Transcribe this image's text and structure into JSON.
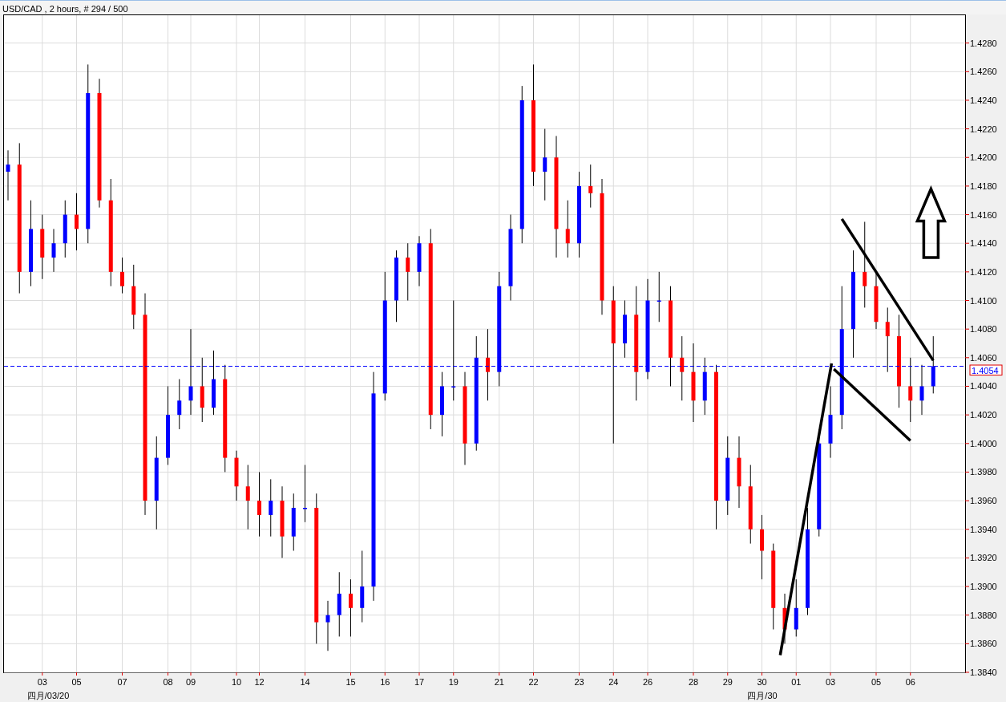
{
  "window": {
    "title": "USD/CAD , 2 hours, # 294 / 500"
  },
  "chart_data": {
    "type": "candlestick",
    "ylim": [
      1.384,
      1.43
    ],
    "grid": true,
    "categories": [
      null,
      null,
      null,
      "03",
      null,
      null,
      "05",
      null,
      null,
      null,
      "07",
      null,
      null,
      null,
      "08",
      null,
      "09",
      null,
      null,
      null,
      "10",
      null,
      "12",
      null,
      null,
      null,
      "14",
      null,
      null,
      null,
      "15",
      null,
      null,
      "16",
      null,
      null,
      "17",
      null,
      null,
      "19",
      null,
      null,
      null,
      "21",
      null,
      null,
      "22",
      null,
      null,
      null,
      "23",
      null,
      null,
      "24",
      null,
      null,
      "26",
      null,
      null,
      null,
      "28",
      null,
      null,
      "29",
      null,
      null,
      "30",
      null,
      null,
      "01",
      null,
      null,
      "03",
      null,
      null,
      null,
      "05",
      null,
      null,
      "06",
      null,
      null
    ],
    "ohlc": [
      [
        1.419,
        1.4205,
        1.417,
        1.4195
      ],
      [
        1.4195,
        1.421,
        1.4105,
        1.412
      ],
      [
        1.412,
        1.417,
        1.411,
        1.415
      ],
      [
        1.415,
        1.416,
        1.4115,
        1.413
      ],
      [
        1.413,
        1.415,
        1.412,
        1.414
      ],
      [
        1.414,
        1.417,
        1.413,
        1.416
      ],
      [
        1.416,
        1.4175,
        1.4135,
        1.415
      ],
      [
        1.415,
        1.4265,
        1.414,
        1.4245
      ],
      [
        1.4245,
        1.4255,
        1.4165,
        1.417
      ],
      [
        1.417,
        1.4185,
        1.411,
        1.412
      ],
      [
        1.412,
        1.413,
        1.4105,
        1.411
      ],
      [
        1.411,
        1.4125,
        1.408,
        1.409
      ],
      [
        1.409,
        1.4105,
        1.395,
        1.396
      ],
      [
        1.396,
        1.4005,
        1.394,
        1.399
      ],
      [
        1.399,
        1.404,
        1.3985,
        1.402
      ],
      [
        1.402,
        1.4045,
        1.401,
        1.403
      ],
      [
        1.403,
        1.408,
        1.402,
        1.404
      ],
      [
        1.404,
        1.406,
        1.4015,
        1.4025
      ],
      [
        1.4025,
        1.4065,
        1.402,
        1.4045
      ],
      [
        1.4045,
        1.4055,
        1.398,
        1.399
      ],
      [
        1.399,
        1.3995,
        1.396,
        1.397
      ],
      [
        1.397,
        1.3985,
        1.394,
        1.396
      ],
      [
        1.396,
        1.398,
        1.3935,
        1.395
      ],
      [
        1.395,
        1.3975,
        1.3935,
        1.396
      ],
      [
        1.396,
        1.397,
        1.392,
        1.3935
      ],
      [
        1.3935,
        1.3965,
        1.3925,
        1.3955
      ],
      [
        1.3955,
        1.3985,
        1.3945,
        1.3955
      ],
      [
        1.3955,
        1.3965,
        1.386,
        1.3875
      ],
      [
        1.3875,
        1.389,
        1.3855,
        1.388
      ],
      [
        1.388,
        1.391,
        1.3865,
        1.3895
      ],
      [
        1.3895,
        1.3905,
        1.3865,
        1.3885
      ],
      [
        1.3885,
        1.3925,
        1.3875,
        1.39
      ],
      [
        1.39,
        1.405,
        1.389,
        1.4035
      ],
      [
        1.4035,
        1.412,
        1.403,
        1.41
      ],
      [
        1.41,
        1.4135,
        1.4085,
        1.413
      ],
      [
        1.413,
        1.414,
        1.41,
        1.412
      ],
      [
        1.412,
        1.4145,
        1.411,
        1.414
      ],
      [
        1.414,
        1.415,
        1.401,
        1.402
      ],
      [
        1.402,
        1.405,
        1.4005,
        1.404
      ],
      [
        1.404,
        1.41,
        1.403,
        1.404
      ],
      [
        1.404,
        1.405,
        1.3985,
        1.4
      ],
      [
        1.4,
        1.4075,
        1.3995,
        1.406
      ],
      [
        1.406,
        1.408,
        1.403,
        1.405
      ],
      [
        1.405,
        1.412,
        1.404,
        1.411
      ],
      [
        1.411,
        1.416,
        1.41,
        1.415
      ],
      [
        1.415,
        1.425,
        1.414,
        1.424
      ],
      [
        1.424,
        1.4265,
        1.418,
        1.419
      ],
      [
        1.419,
        1.422,
        1.417,
        1.42
      ],
      [
        1.42,
        1.4215,
        1.413,
        1.415
      ],
      [
        1.415,
        1.417,
        1.413,
        1.414
      ],
      [
        1.414,
        1.419,
        1.413,
        1.418
      ],
      [
        1.418,
        1.4195,
        1.4165,
        1.4175
      ],
      [
        1.4175,
        1.4185,
        1.409,
        1.41
      ],
      [
        1.41,
        1.411,
        1.4,
        1.407
      ],
      [
        1.407,
        1.41,
        1.406,
        1.409
      ],
      [
        1.409,
        1.411,
        1.403,
        1.405
      ],
      [
        1.405,
        1.4115,
        1.4045,
        1.41
      ],
      [
        1.41,
        1.412,
        1.4085,
        1.41
      ],
      [
        1.41,
        1.411,
        1.404,
        1.406
      ],
      [
        1.406,
        1.4075,
        1.403,
        1.405
      ],
      [
        1.405,
        1.407,
        1.4015,
        1.403
      ],
      [
        1.403,
        1.406,
        1.402,
        1.405
      ],
      [
        1.405,
        1.4055,
        1.394,
        1.396
      ],
      [
        1.396,
        1.4005,
        1.395,
        1.399
      ],
      [
        1.399,
        1.4005,
        1.3955,
        1.397
      ],
      [
        1.397,
        1.3985,
        1.393,
        1.394
      ],
      [
        1.394,
        1.395,
        1.3905,
        1.3925
      ],
      [
        1.3925,
        1.393,
        1.387,
        1.3885
      ],
      [
        1.3885,
        1.3895,
        1.386,
        1.387
      ],
      [
        1.387,
        1.3905,
        1.3865,
        1.3885
      ],
      [
        1.3885,
        1.3955,
        1.388,
        1.394
      ],
      [
        1.394,
        1.401,
        1.3935,
        1.4
      ],
      [
        1.4,
        1.404,
        1.399,
        1.402
      ],
      [
        1.402,
        1.411,
        1.401,
        1.408
      ],
      [
        1.408,
        1.4135,
        1.406,
        1.412
      ],
      [
        1.412,
        1.4155,
        1.4095,
        1.411
      ],
      [
        1.411,
        1.412,
        1.408,
        1.4085
      ],
      [
        1.4085,
        1.4095,
        1.405,
        1.4075
      ],
      [
        1.4075,
        1.409,
        1.4025,
        1.404
      ],
      [
        1.404,
        1.406,
        1.4015,
        1.403
      ],
      [
        1.403,
        1.4055,
        1.402,
        1.404
      ],
      [
        1.404,
        1.4075,
        1.4035,
        1.4054
      ]
    ],
    "yticks": [
      {
        "value": 1.384,
        "label": "1.3840"
      },
      {
        "value": 1.386,
        "label": "1.3860"
      },
      {
        "value": 1.388,
        "label": "1.3880"
      },
      {
        "value": 1.39,
        "label": "1.3900"
      },
      {
        "value": 1.392,
        "label": "1.3920"
      },
      {
        "value": 1.394,
        "label": "1.3940"
      },
      {
        "value": 1.396,
        "label": "1.3960"
      },
      {
        "value": 1.398,
        "label": "1.3980"
      },
      {
        "value": 1.4,
        "label": "1.4000"
      },
      {
        "value": 1.402,
        "label": "1.4020"
      },
      {
        "value": 1.404,
        "label": "1.4040"
      },
      {
        "value": 1.406,
        "label": "1.4060"
      },
      {
        "value": 1.408,
        "label": "1.4080"
      },
      {
        "value": 1.41,
        "label": "1.4100"
      },
      {
        "value": 1.412,
        "label": "1.4120"
      },
      {
        "value": 1.414,
        "label": "1.4140"
      },
      {
        "value": 1.416,
        "label": "1.4160"
      },
      {
        "value": 1.418,
        "label": "1.4180"
      },
      {
        "value": 1.42,
        "label": "1.4200"
      },
      {
        "value": 1.422,
        "label": "1.4220"
      },
      {
        "value": 1.424,
        "label": "1.4240"
      },
      {
        "value": 1.426,
        "label": "1.4260"
      },
      {
        "value": 1.428,
        "label": "1.4280"
      }
    ],
    "ref_lines": [
      {
        "axis": "y",
        "value": 1.4054,
        "label": "1.4054"
      }
    ],
    "annotations": [
      "四月/03/20",
      "四月/30"
    ]
  }
}
